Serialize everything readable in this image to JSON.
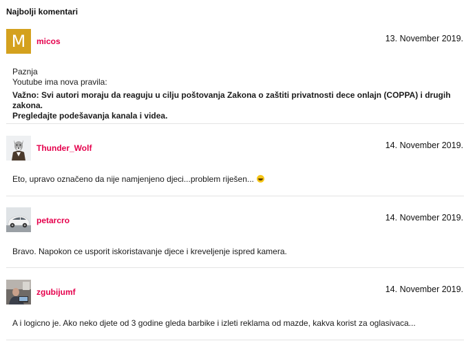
{
  "section": {
    "title": "Najbolji komentari"
  },
  "comments": [
    {
      "username": "micos",
      "date": "13. November 2019.",
      "avatar_letter": "M",
      "avatar_color": "#d4a11e",
      "lines": [
        "Paznja",
        "Youtube ima nova pravila:"
      ],
      "bold_lines": [
        "Važno: Svi autori moraju da reaguju u cilju poštovanja Zakona o zaštiti privatnosti dece onlajn (COPPA) i drugih zakona.",
        "Pregledajte podešavanja kanala i videa."
      ]
    },
    {
      "username": "Thunder_Wolf",
      "date": "14. November 2019.",
      "avatar_icon": "wolf-avatar-icon",
      "text": "Eto, upravo označeno da nije namjenjeno djeci...problem riješen...",
      "emoji": "laughing-emoji-icon"
    },
    {
      "username": "petarcro",
      "date": "14. November 2019.",
      "avatar_icon": "car-avatar-icon",
      "text": "Bravo. Napokon ce usporit iskoristavanje djece i kreveljenje ispred kamera."
    },
    {
      "username": "zgubijumf",
      "date": "14. November 2019.",
      "avatar_icon": "person-photo-avatar-icon",
      "text": "A i logicno je. Ako neko djete od 3 godine gleda barbike i izleti reklama od mazde, kakva korist za oglasivaca..."
    }
  ],
  "colors": {
    "username": "#e5004c",
    "divider": "#e3e3e3"
  }
}
